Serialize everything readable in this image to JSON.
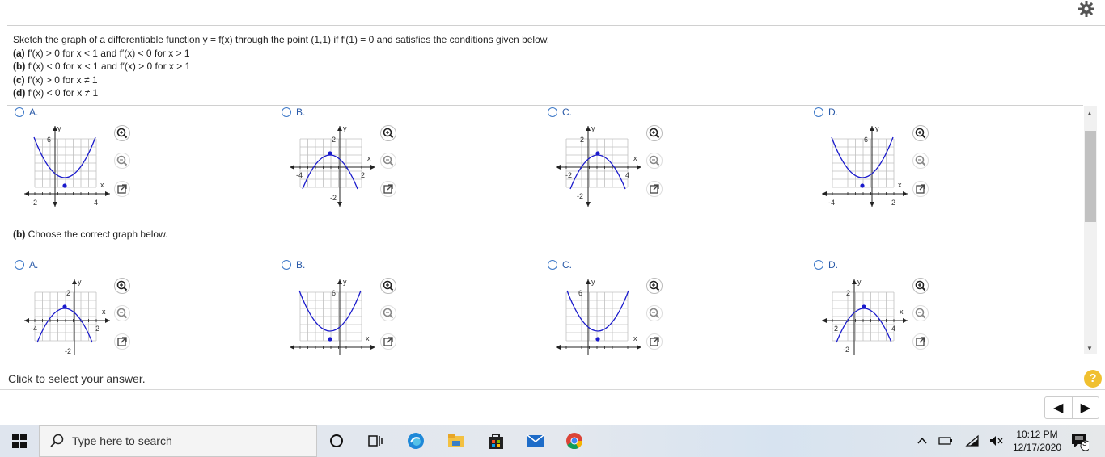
{
  "question": {
    "intro": "Sketch the graph of a differentiable function y = f(x) through the point (1,1) if f′(1) = 0 and satisfies the conditions given below.",
    "conditions": [
      {
        "label": "(a)",
        "text": " f′(x) > 0 for x < 1 and f′(x) < 0 for x > 1"
      },
      {
        "label": "(b)",
        "text": " f′(x) < 0 for x < 1 and f′(x) > 0 for x > 1"
      },
      {
        "label": "(c)",
        "text": " f′(x) > 0 for x ≠ 1"
      },
      {
        "label": "(d)",
        "text": " f′(x) < 0 for x ≠ 1"
      }
    ]
  },
  "part_a": {
    "options": [
      {
        "label": "A.",
        "graph": {
          "shape": "up",
          "ticks": [
            "6",
            "-2",
            "4",
            "x",
            "y"
          ]
        }
      },
      {
        "label": "B.",
        "graph": {
          "shape": "down",
          "ticks": [
            "2",
            "-4",
            "2",
            "-2",
            "x",
            "y"
          ]
        }
      },
      {
        "label": "C.",
        "graph": {
          "shape": "down",
          "ticks": [
            "2",
            "-2",
            "4",
            "-2",
            "x",
            "y"
          ]
        }
      },
      {
        "label": "D.",
        "graph": {
          "shape": "up",
          "ticks": [
            "6",
            "-4",
            "2",
            "x",
            "y"
          ]
        }
      }
    ]
  },
  "part_b": {
    "label": "(b)",
    "prompt": " Choose the correct graph below.",
    "options": [
      {
        "label": "A.",
        "graph": {
          "shape": "down",
          "ticks": [
            "2",
            "-4",
            "2",
            "-2",
            "x",
            "y"
          ]
        }
      },
      {
        "label": "B.",
        "graph": {
          "shape": "up",
          "ticks": [
            "6",
            "x",
            "y"
          ]
        }
      },
      {
        "label": "C.",
        "graph": {
          "shape": "up",
          "ticks": [
            "6",
            "x",
            "y"
          ]
        }
      },
      {
        "label": "D.",
        "graph": {
          "shape": "down",
          "ticks": [
            "2",
            "-2",
            "4",
            "-2",
            "x",
            "y"
          ]
        }
      }
    ]
  },
  "status": {
    "text": "Click to select your answer.",
    "help": "?"
  },
  "nav": {
    "prev": "◀",
    "next": "▶"
  },
  "taskbar": {
    "search_placeholder": "Type here to search",
    "time": "10:12 PM",
    "date": "12/17/2020",
    "notification_count": "3"
  },
  "colors": {
    "accent": "#2a5aa8",
    "curve": "#1a1acc",
    "grid": "#b8b8b8"
  }
}
